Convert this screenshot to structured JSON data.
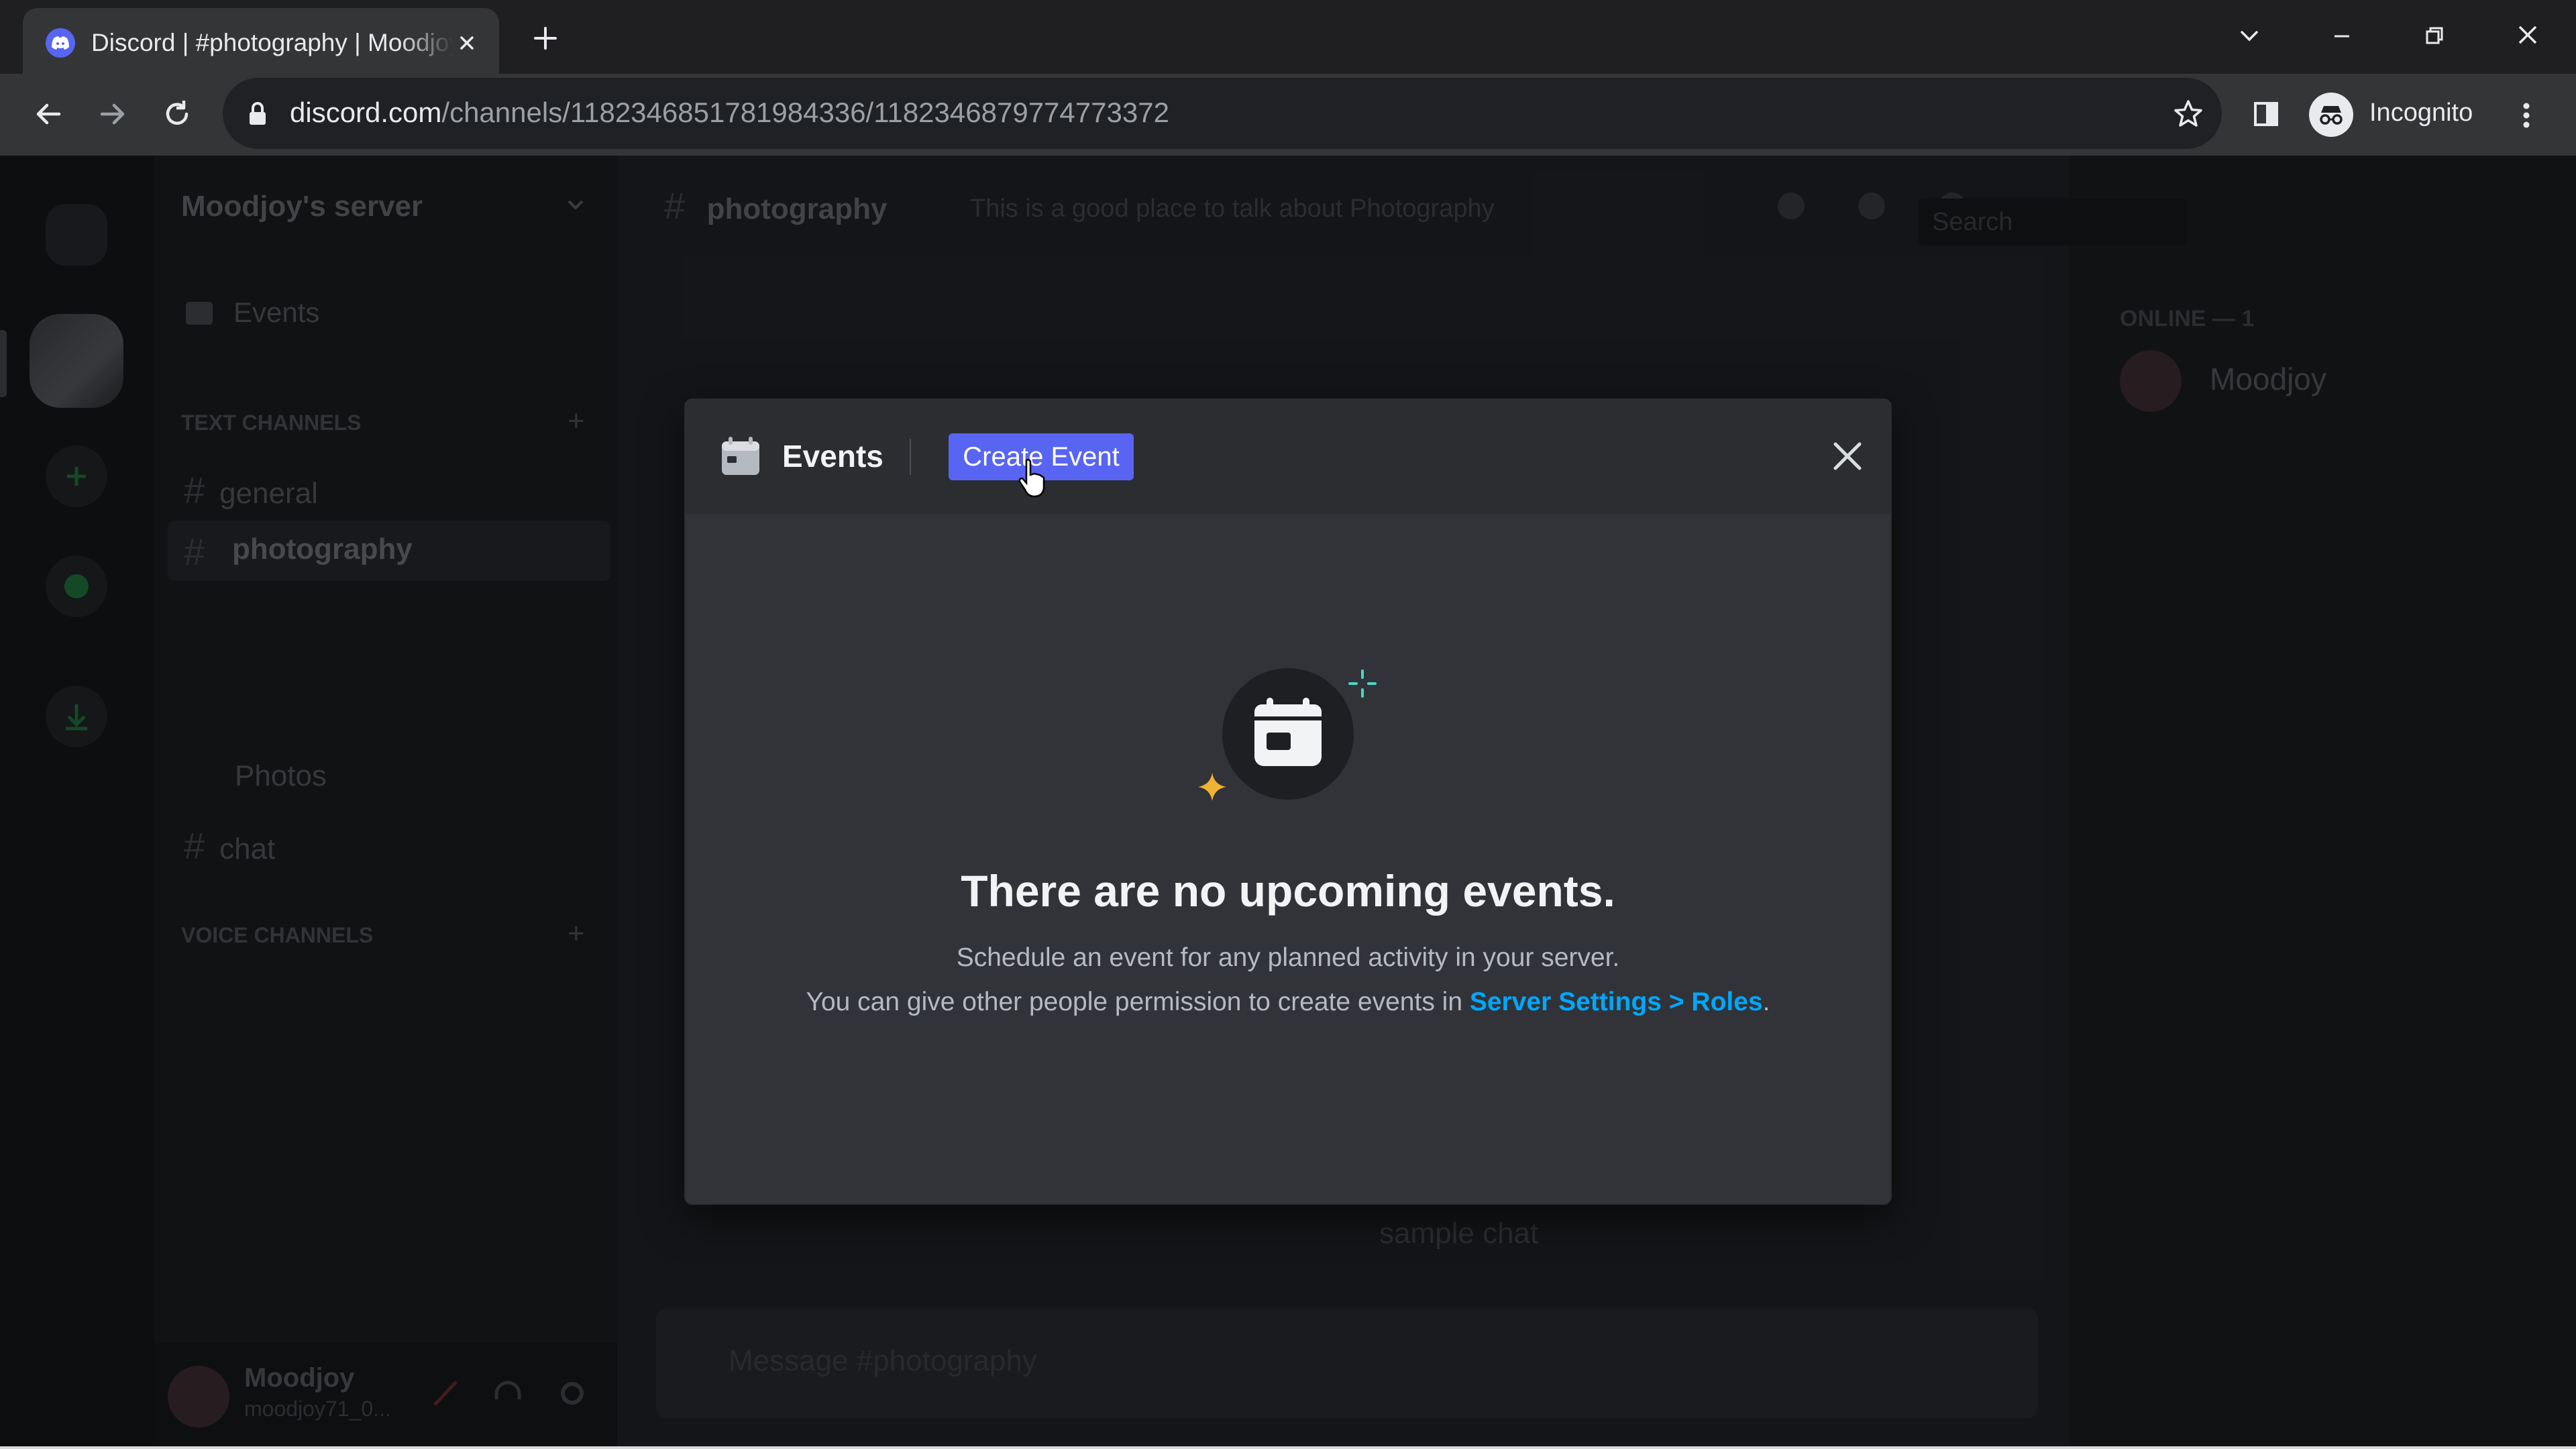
{
  "browser": {
    "tab_title": "Discord | #photography | Moodjoy's server",
    "new_tab_icon": "plus-icon",
    "url_host": "discord.com",
    "url_path": "/channels/1182346851781984336/1182346879774773372",
    "incognito_label": "Incognito"
  },
  "server": {
    "name": "Moodjoy's server",
    "events_label": "Events",
    "text_channels_label": "TEXT CHANNELS",
    "voice_channels_label": "VOICE CHANNELS",
    "channels": [
      "general",
      "photography",
      "Photos",
      "chat"
    ]
  },
  "channel_header": {
    "name": "photography",
    "topic": "This is a good place to talk about Photography",
    "search_placeholder": "Search"
  },
  "chat": {
    "sample_message": "sample chat",
    "input_placeholder": "Message #photography"
  },
  "members": {
    "online_header": "ONLINE — 1",
    "member_name": "Moodjoy"
  },
  "user_panel": {
    "name": "Moodjoy",
    "tag": "moodjoy71_0..."
  },
  "modal": {
    "title": "Events",
    "create_button": "Create Event",
    "empty_title": "There are no upcoming events.",
    "empty_line1": "Schedule an event for any planned activity in your server.",
    "empty_line2_prefix": "You can give other people permission to create events in ",
    "settings_link": "Server Settings > Roles",
    "empty_line2_suffix": "."
  },
  "colors": {
    "blurple": "#5865f2",
    "link": "#00a8fc",
    "modal_bg": "#313338",
    "modal_header_bg": "#2b2d31",
    "sparkle_yellow": "#f0b232",
    "sparkle_teal": "#49d8c4"
  }
}
